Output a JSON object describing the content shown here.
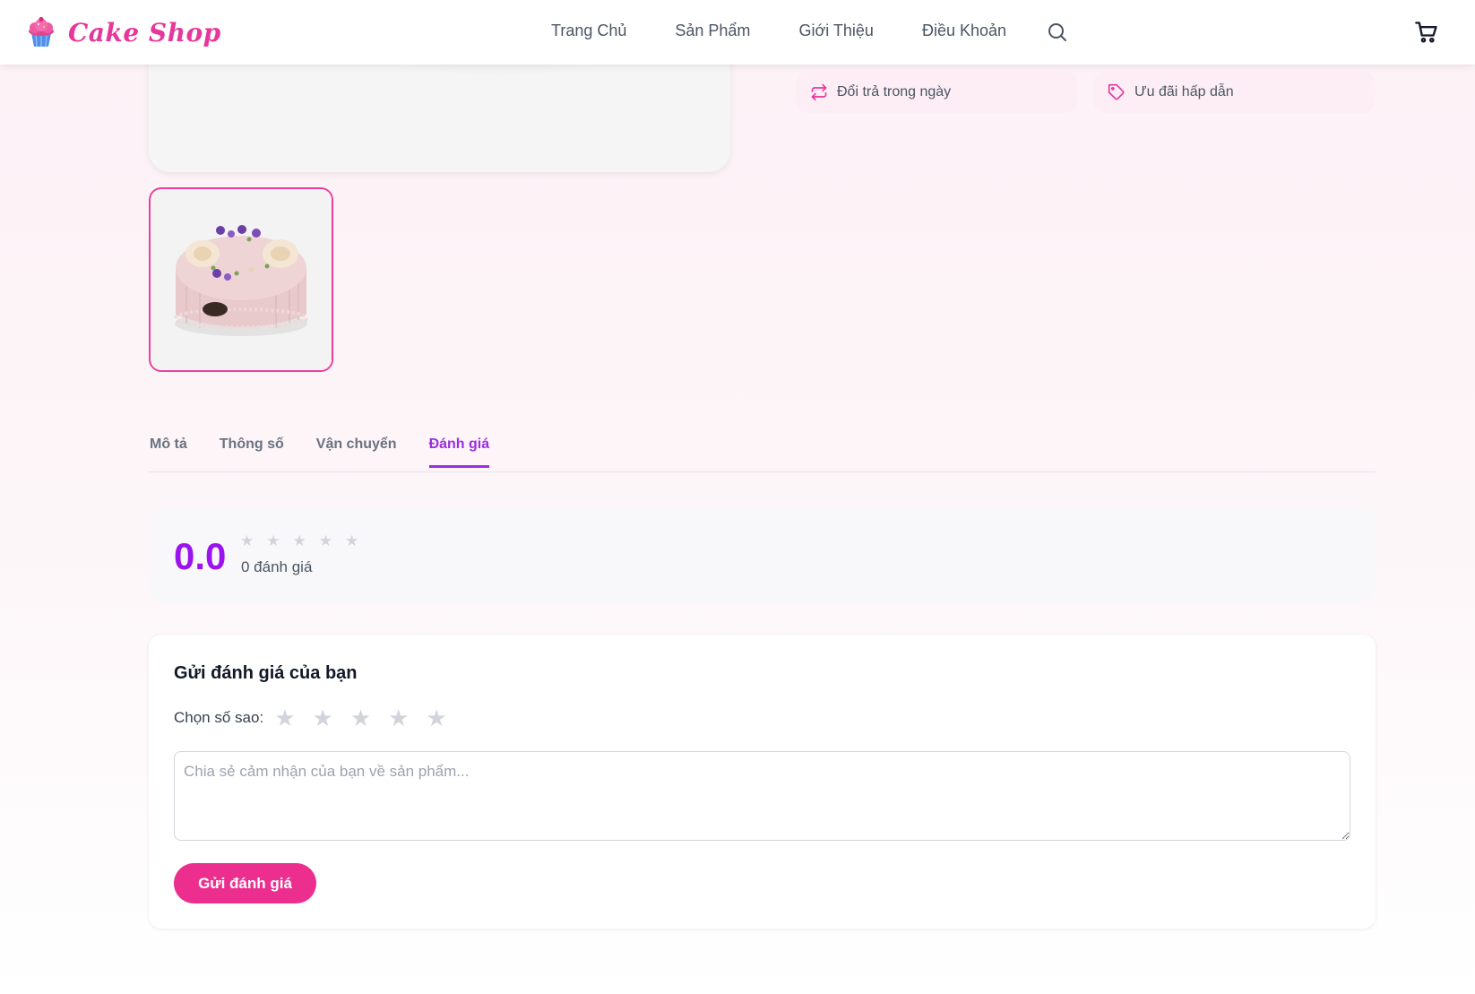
{
  "brand": {
    "name": "Cake Shop",
    "logo_icon": "cupcake-icon",
    "color": "#e6379b"
  },
  "nav": {
    "items": [
      {
        "label": "Trang Chủ"
      },
      {
        "label": "Sản Phẩm"
      },
      {
        "label": "Giới Thiệu"
      },
      {
        "label": "Điều Khoản"
      }
    ],
    "search_icon": "search-icon",
    "cart_icon": "cart-icon"
  },
  "features": [
    {
      "icon": "exchange-arrows-icon",
      "label": "Đổi trả trong ngày"
    },
    {
      "icon": "tag-icon",
      "label": "Ưu đãi hấp dẫn"
    }
  ],
  "thumbnail": {
    "subject": "pink-cake-with-flowers",
    "selected": true
  },
  "tabs": {
    "items": [
      {
        "label": "Mô tả"
      },
      {
        "label": "Thông số"
      },
      {
        "label": "Vận chuyển"
      },
      {
        "label": "Đánh giá"
      }
    ],
    "active": "Đánh giá",
    "active_color": "#9b2ee0"
  },
  "rating": {
    "score": "0.0",
    "count_label": "0 đánh giá",
    "stars_filled": 0,
    "stars_total": 5,
    "score_color": "#9b14f0"
  },
  "review_form": {
    "title": "Gửi đánh giá của bạn",
    "star_label": "Chọn số sao:",
    "selected_stars": 0,
    "textarea_placeholder": "Chia sẻ cảm nhận của bạn về sản phẩm...",
    "textarea_value": "",
    "submit_label": "Gửi đánh giá",
    "button_color": "#ec2f8e"
  }
}
